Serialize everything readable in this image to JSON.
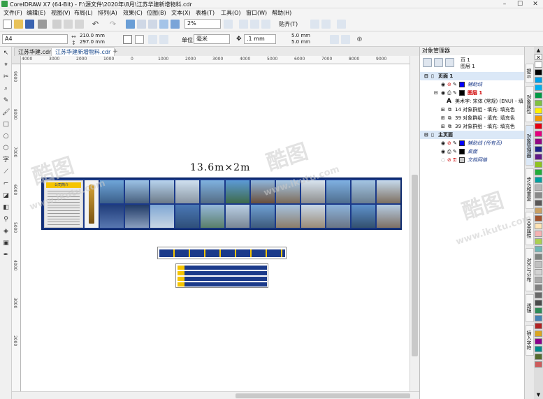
{
  "window": {
    "title": "CorelDRAW X7 (64-Bit) - F:\\源文件\\2020年\\8月\\江苏华建新增物料.cdr"
  },
  "menu": [
    "文件(F)",
    "编辑(E)",
    "视图(V)",
    "布局(L)",
    "排列(A)",
    "效果(C)",
    "位图(B)",
    "文本(X)",
    "表格(T)",
    "工具(O)",
    "窗口(W)",
    "帮助(H)"
  ],
  "standard_toolbar": {
    "zoom": "2%",
    "snap": "贴齐(T)"
  },
  "property_bar": {
    "page_size": "A4",
    "width": "210.0 mm",
    "height": "297.0 mm",
    "units_label": "单位:",
    "units": "毫米",
    "nudge": ".1 mm",
    "dup_x": "5.0 mm",
    "dup_y": "5.0 mm"
  },
  "doc_tabs": [
    "江苏华建.cdr",
    "江苏华建新增物料.cdr"
  ],
  "ruler_labels": [
    "4000",
    "3000",
    "2000",
    "1000",
    "0",
    "1000",
    "2000",
    "3000",
    "4000",
    "5000",
    "6000",
    "7000",
    "8000",
    "9000"
  ],
  "vruler_labels": [
    "9000",
    "8000",
    "7000",
    "6000",
    "5000",
    "4000",
    "3000",
    "2000"
  ],
  "canvas": {
    "banner_caption": "13.6m×2m",
    "sign_title": "公司简介"
  },
  "object_manager": {
    "title": "对象管理器",
    "page": "页 1",
    "layer": "图层 1",
    "rows": [
      {
        "label": "页面 1"
      },
      {
        "label": "辅助线"
      },
      {
        "label": "图层 1"
      },
      {
        "label": "美术字: 宋体 (常规) (ENU) - 填"
      },
      {
        "label": "14 对象群组 - 填充: 填充色"
      },
      {
        "label": "39 对象群组 - 填充: 填充色"
      },
      {
        "label": "39 对象群组 - 填充: 填充色"
      },
      {
        "label": "主页面"
      },
      {
        "label": "辅助线 (所有页)"
      },
      {
        "label": "桌面"
      },
      {
        "label": "文档网格"
      }
    ]
  },
  "dock_tabs": [
    "提示",
    "对象属性",
    "对象管理器",
    "步长和重复",
    "文本属性",
    "对齐与分布",
    "透镜",
    "插入字符"
  ],
  "palette": [
    "#ffffff",
    "#000000",
    "#00a0e9",
    "#00b0f0",
    "#009944",
    "#7fc241",
    "#fff100",
    "#f39800",
    "#e60012",
    "#e4007f",
    "#920783",
    "#1d2088",
    "#601986",
    "#8fc31f",
    "#22ac38",
    "#00a0a0",
    "#b5b5b6",
    "#898989",
    "#595757",
    "#c9a063",
    "#a0522d",
    "#ffe4b5",
    "#f5b2b2",
    "#aacf53",
    "#6fb7b7",
    "#7e837f",
    "#c0c0c0",
    "#d3d3d3",
    "#a9a9a9",
    "#808080",
    "#696969",
    "#4a4a4a",
    "#2e8b57",
    "#4682b4",
    "#b22222",
    "#daa520",
    "#8b008b",
    "#008b8b",
    "#556b2f",
    "#cd5c5c"
  ],
  "watermark": {
    "brand": "酷图",
    "url": "www.ikutu.com"
  }
}
